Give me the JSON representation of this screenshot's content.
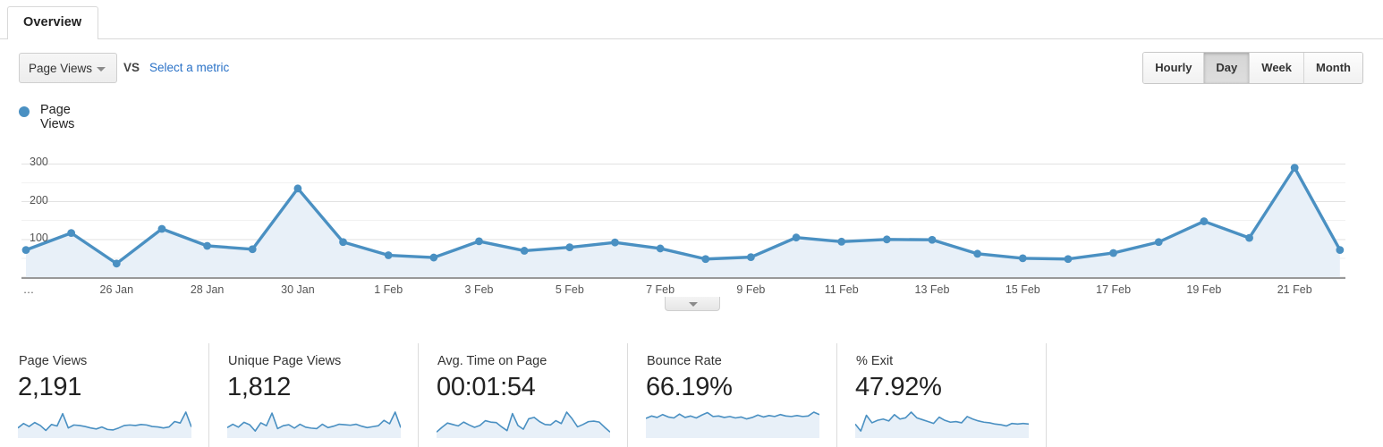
{
  "tab": {
    "label": "Overview"
  },
  "controls": {
    "metric_selected": "Page Views",
    "vs_label": "VS",
    "compare_link": "Select a metric",
    "granularity": [
      {
        "label": "Hourly",
        "active": false
      },
      {
        "label": "Day",
        "active": true
      },
      {
        "label": "Week",
        "active": false
      },
      {
        "label": "Month",
        "active": false
      }
    ]
  },
  "legend": {
    "label": "Page Views",
    "color": "#4a90c2"
  },
  "chart_data": {
    "type": "area",
    "title": "Page Views",
    "xlabel": "",
    "ylabel": "",
    "ylim": [
      0,
      320
    ],
    "yticks": [
      100,
      200,
      300
    ],
    "grid": true,
    "legend_position": "top-left",
    "line_color": "#4a90c2",
    "fill_color": "#e8f0f8",
    "xtick_labels": [
      "…",
      "26 Jan",
      "28 Jan",
      "30 Jan",
      "1 Feb",
      "3 Feb",
      "5 Feb",
      "7 Feb",
      "9 Feb",
      "11 Feb",
      "13 Feb",
      "15 Feb",
      "17 Feb",
      "19 Feb",
      "21 Feb"
    ],
    "x": [
      "24 Jan",
      "25 Jan",
      "26 Jan",
      "27 Jan",
      "28 Jan",
      "29 Jan",
      "30 Jan",
      "31 Jan",
      "1 Feb",
      "2 Feb",
      "3 Feb",
      "4 Feb",
      "5 Feb",
      "6 Feb",
      "7 Feb",
      "8 Feb",
      "9 Feb",
      "10 Feb",
      "11 Feb",
      "12 Feb",
      "13 Feb",
      "14 Feb",
      "15 Feb",
      "16 Feb",
      "17 Feb",
      "18 Feb",
      "19 Feb",
      "20 Feb",
      "21 Feb",
      "22 Feb"
    ],
    "values": [
      72,
      117,
      36,
      128,
      83,
      74,
      235,
      93,
      58,
      52,
      95,
      70,
      79,
      92,
      76,
      48,
      53,
      105,
      94,
      100,
      99,
      62,
      50,
      48,
      64,
      93,
      148,
      104,
      290,
      72
    ]
  },
  "collapse_handle": {
    "label": ""
  },
  "cards": [
    {
      "title": "Page Views",
      "value": "2,191",
      "spark": [
        30,
        48,
        36,
        52,
        40,
        20,
        44,
        38,
        88,
        30,
        42,
        40,
        36,
        30,
        26,
        34,
        24,
        22,
        30,
        40,
        42,
        40,
        44,
        42,
        36,
        34,
        30,
        34,
        56,
        50,
        94,
        34
      ],
      "filled": true
    },
    {
      "title": "Unique Page Views",
      "value": "1,812",
      "spark": [
        32,
        46,
        34,
        54,
        44,
        18,
        52,
        40,
        92,
        28,
        40,
        44,
        30,
        46,
        34,
        30,
        28,
        46,
        32,
        38,
        46,
        44,
        42,
        46,
        38,
        32,
        36,
        40,
        62,
        48,
        96,
        32
      ],
      "filled": true
    },
    {
      "title": "Avg. Time on Page",
      "value": "00:01:54",
      "spark": [
        14,
        34,
        52,
        46,
        40,
        56,
        44,
        34,
        42,
        62,
        56,
        54,
        36,
        20,
        92,
        42,
        26,
        70,
        76,
        58,
        46,
        44,
        62,
        50,
        98,
        70,
        36,
        46,
        58,
        60,
        56,
        34,
        14
      ],
      "filled": true
    },
    {
      "title": "Bounce Rate",
      "value": "66.19%",
      "spark": [
        70,
        80,
        74,
        86,
        76,
        72,
        88,
        74,
        80,
        72,
        84,
        94,
        78,
        80,
        74,
        78,
        72,
        76,
        68,
        74,
        84,
        76,
        82,
        78,
        86,
        80,
        78,
        82,
        78,
        80,
        96,
        86
      ],
      "filled": true
    },
    {
      "title": "% Exit",
      "value": "47.92%",
      "spark": [
        36,
        14,
        64,
        40,
        48,
        52,
        46,
        66,
        52,
        56,
        74,
        56,
        50,
        44,
        38,
        58,
        48,
        42,
        44,
        40,
        60,
        52,
        46,
        42,
        40,
        36,
        34,
        30,
        38,
        36,
        38,
        36
      ],
      "filled": true
    }
  ]
}
